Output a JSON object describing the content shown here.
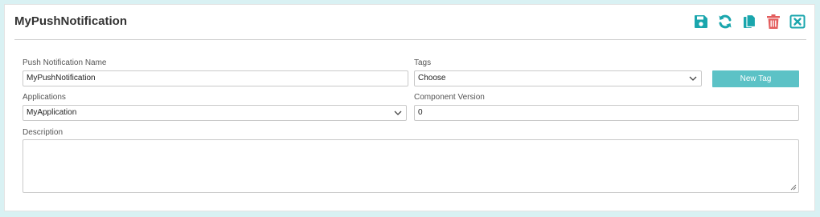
{
  "header": {
    "title": "MyPushNotification"
  },
  "toolbar": {
    "icons": [
      "save-icon",
      "refresh-icon",
      "copy-icon",
      "delete-icon",
      "close-icon"
    ],
    "colors": {
      "primary": "#1aa6ad",
      "danger": "#e35d5d"
    }
  },
  "form": {
    "name": {
      "label": "Push Notification Name",
      "value": "MyPushNotification"
    },
    "tags": {
      "label": "Tags",
      "selected": "Choose",
      "new_tag_label": "New Tag"
    },
    "applications": {
      "label": "Applications",
      "selected": "MyApplication"
    },
    "component_version": {
      "label": "Component Version",
      "value": "0"
    },
    "description": {
      "label": "Description",
      "value": ""
    }
  }
}
